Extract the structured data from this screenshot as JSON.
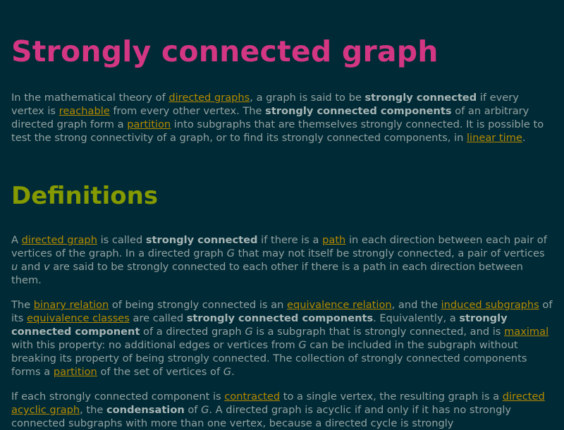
{
  "title": "Strongly connected graph",
  "intro": [
    {
      "t": "In the mathematical theory of "
    },
    {
      "t": "directed graphs",
      "k": "link"
    },
    {
      "t": ", a graph is said to be "
    },
    {
      "t": "strongly connected",
      "k": "bold"
    },
    {
      "t": " if every vertex is "
    },
    {
      "t": "reachable",
      "k": "link"
    },
    {
      "t": " from every other vertex. The "
    },
    {
      "t": "strongly connected components",
      "k": "bold"
    },
    {
      "t": " of an arbitrary directed graph form a "
    },
    {
      "t": "partition",
      "k": "link"
    },
    {
      "t": " into subgraphs that are themselves strongly connected. It is possible to test the strong connectivity of a graph, or to find its strongly connected components, in "
    },
    {
      "t": "linear time",
      "k": "link"
    },
    {
      "t": "."
    }
  ],
  "section_heading": "Definitions",
  "def1": [
    {
      "t": "A "
    },
    {
      "t": "directed graph",
      "k": "link"
    },
    {
      "t": " is called "
    },
    {
      "t": "strongly connected",
      "k": "bold"
    },
    {
      "t": " if there is a "
    },
    {
      "t": "path",
      "k": "link"
    },
    {
      "t": " in each direction between each pair of vertices of the graph. In a directed graph "
    },
    {
      "t": "G",
      "k": "ital"
    },
    {
      "t": " that may not itself be strongly connected, a pair of vertices "
    },
    {
      "t": "u",
      "k": "ital"
    },
    {
      "t": " and "
    },
    {
      "t": "v",
      "k": "ital"
    },
    {
      "t": " are said to be strongly connected to each other if there is a path in each direction between them."
    }
  ],
  "def2": [
    {
      "t": "The "
    },
    {
      "t": "binary relation",
      "k": "link"
    },
    {
      "t": " of being strongly connected is an "
    },
    {
      "t": "equivalence relation",
      "k": "link"
    },
    {
      "t": ", and the "
    },
    {
      "t": "induced subgraphs",
      "k": "link"
    },
    {
      "t": " of its "
    },
    {
      "t": "equivalence classes",
      "k": "link"
    },
    {
      "t": " are called "
    },
    {
      "t": "strongly connected components",
      "k": "bold"
    },
    {
      "t": ". Equivalently, a "
    },
    {
      "t": "strongly connected component",
      "k": "bold"
    },
    {
      "t": " of a directed graph "
    },
    {
      "t": "G",
      "k": "ital"
    },
    {
      "t": " is a subgraph that is strongly connected, and is "
    },
    {
      "t": "maximal",
      "k": "link"
    },
    {
      "t": " with this property: no additional edges or vertices from "
    },
    {
      "t": "G",
      "k": "ital"
    },
    {
      "t": " can be included in the subgraph without breaking its property of being strongly connected. The collection of strongly connected components forms a "
    },
    {
      "t": "partition",
      "k": "link"
    },
    {
      "t": " of the set of vertices of "
    },
    {
      "t": "G",
      "k": "ital"
    },
    {
      "t": "."
    }
  ],
  "def3": [
    {
      "t": "If each strongly connected component is "
    },
    {
      "t": "contracted",
      "k": "link"
    },
    {
      "t": " to a single vertex, the resulting graph is a "
    },
    {
      "t": "directed acyclic graph",
      "k": "link"
    },
    {
      "t": ", the "
    },
    {
      "t": "condensation",
      "k": "bold"
    },
    {
      "t": " of "
    },
    {
      "t": "G",
      "k": "ital"
    },
    {
      "t": ". A directed graph is acyclic if and only if it has no strongly connected subgraphs with more than one vertex, because a directed cycle is strongly"
    }
  ],
  "colors": {
    "background": "#002b36",
    "text": "#93a1a1",
    "title": "#d33682",
    "heading": "#859900",
    "link": "#b58900"
  }
}
